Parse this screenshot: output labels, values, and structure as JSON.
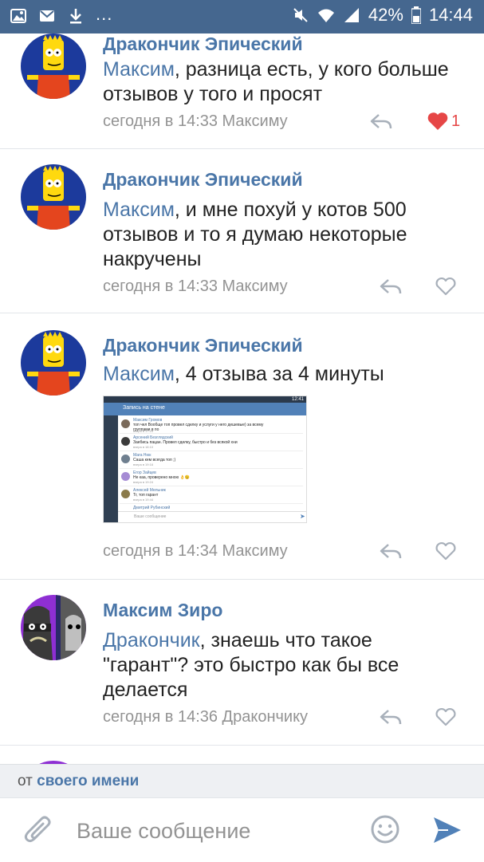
{
  "status_bar": {
    "battery_percent": "42%",
    "time": "14:44",
    "overflow": "..."
  },
  "comments": [
    {
      "author": "Дракончик Эпический",
      "addressee": "Максим",
      "text": ", разница есть, у кого больше отзывов у того и просят",
      "meta": "сегодня в 14:33 Максиму",
      "liked": true,
      "likes": "1",
      "avatar": "bart-avatar"
    },
    {
      "author": "Дракончик Эпический",
      "addressee": "Максим",
      "text": ", и мне похуй у котов 500 отзывов и то я думаю некоторые накручены",
      "meta": "сегодня в 14:33 Максиму",
      "liked": false,
      "avatar": "bart-avatar"
    },
    {
      "author": "Дракончик Эпический",
      "addressee": "Максим",
      "text": ", 4 отзыва за 4 минуты",
      "meta": "сегодня в 14:34 Максиму",
      "liked": false,
      "avatar": "bart-avatar",
      "attachment": {
        "type": "screenshot",
        "header_title": "Запись на стене",
        "status_time": "12:41",
        "rows": [
          {
            "name": "Максим Громов",
            "text": "топ чел Вообще топ провел сделку и услуги у него дешевые) за всему группами в по",
            "date": "вчера в 17:29"
          },
          {
            "name": "Арсений Безглядский",
            "text": "Заебись пацан. Провел сделку, быстро и без всякой хни",
            "date": "вчера в 18:10"
          },
          {
            "name": "Мага Нюк",
            "text": "Саша кем всегда топ ;)",
            "date": "вчера в 19:16"
          },
          {
            "name": "Егор Зайцев",
            "text": "Не каа, проверено мною 👌😉",
            "date": "вчера в 19:24"
          },
          {
            "name": "Алексей Мельник",
            "text": "Тг, топ гарант",
            "date": "вчера в 19:44"
          },
          {
            "name": "Дмитрий Рубинский",
            "text": "",
            "date": ""
          }
        ],
        "input_placeholder": "Ваше сообщение"
      }
    },
    {
      "author": "Максим Зиро",
      "addressee": "Дракончик",
      "text": ", знаешь что такое \"гарант\"? это быстро как бы все делается",
      "meta": "сегодня в 14:36 Дракончику",
      "liked": false,
      "avatar": "cartoon-avatar"
    }
  ],
  "sender_bar": {
    "prefix": "от",
    "link": "своего имени"
  },
  "composer": {
    "placeholder": "Ваше сообщение"
  },
  "colors": {
    "status_bar": "#45678f",
    "link": "#4a76a8",
    "meta": "#939393",
    "like": "#e64646"
  }
}
